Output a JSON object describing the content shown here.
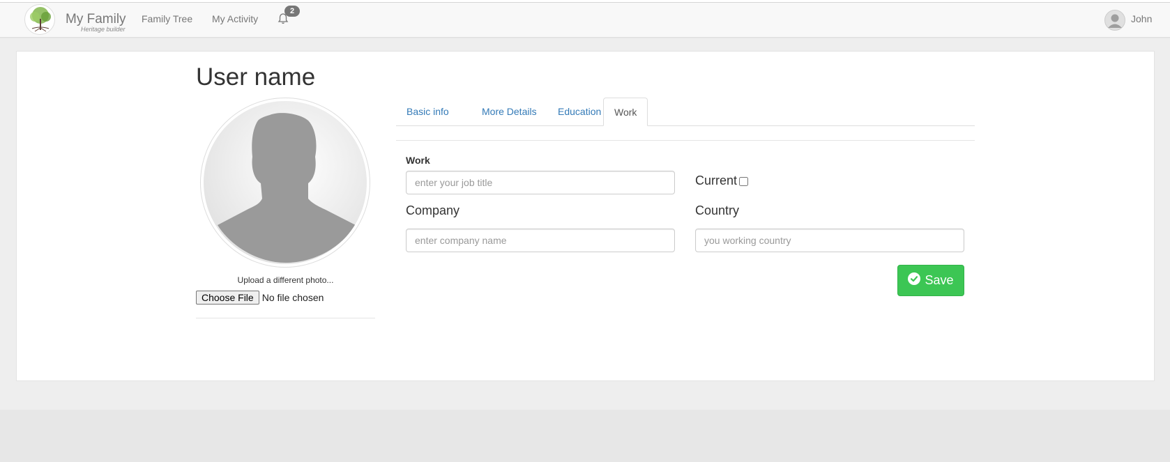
{
  "navbar": {
    "brand_name": "My Family",
    "brand_subtitle": "Heritage builder",
    "logo_text": "My Family",
    "links": [
      {
        "label": "Family Tree"
      },
      {
        "label": "My Activity"
      }
    ],
    "notifications_count": "2",
    "user_name": "John"
  },
  "profile": {
    "title": "User name",
    "upload_label": "Upload a different photo...",
    "file_button": "Choose File",
    "file_status": "No file chosen"
  },
  "tabs": [
    {
      "label": "Basic info",
      "active": false
    },
    {
      "label": "More Details",
      "active": false
    },
    {
      "label": "Education",
      "active": false
    },
    {
      "label": "Work",
      "active": true
    }
  ],
  "form": {
    "work_label": "Work",
    "work_placeholder": "enter your job title",
    "current_label": "Current",
    "current_checked": false,
    "company_label": "Company",
    "company_placeholder": "enter company name",
    "country_label": "Country",
    "country_placeholder": "you working country",
    "save_label": "Save"
  },
  "colors": {
    "save_button": "#3cc654",
    "link": "#337ab7",
    "badge": "#777777"
  },
  "icons": {
    "bell": "bell-icon",
    "save": "check-circle-icon",
    "user": "user-avatar-icon"
  }
}
